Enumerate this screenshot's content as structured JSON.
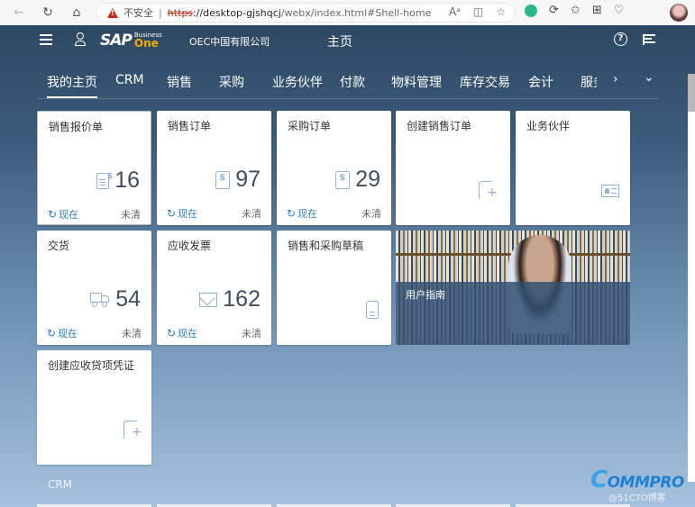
{
  "browser": {
    "insecure_label": "不安全",
    "url_scheme": "https",
    "url_host": "://desktop-gjshqcj",
    "url_path": "/webx/index.html#Shell-home",
    "icons": [
      "back-icon",
      "reload-icon",
      "home-icon",
      "read-aloud-icon",
      "split-screen-icon",
      "favorite-star-icon",
      "copilot-icon",
      "extensions-icon",
      "favorites-icon",
      "collections-icon",
      "browser-health-icon",
      "profile-avatar"
    ]
  },
  "shell": {
    "brand_primary": "SAP",
    "brand_business": "Business",
    "brand_one": "One",
    "company": "OEC中国有限公司",
    "title": "主页",
    "help_icon_label": "?",
    "accent_color": "#2d80c7",
    "brand_yellow": "#f0ab00"
  },
  "tabs": [
    {
      "label": "我的主页",
      "active": true
    },
    {
      "label": "CRM",
      "active": false
    },
    {
      "label": "销售",
      "active": false
    },
    {
      "label": "采购",
      "active": false
    },
    {
      "label": "业务伙伴",
      "active": false
    },
    {
      "label": "付款",
      "active": false
    },
    {
      "label": "物料管理",
      "active": false
    },
    {
      "label": "库存交易",
      "active": false
    },
    {
      "label": "会计",
      "active": false
    },
    {
      "label": "服务",
      "active": false
    }
  ],
  "tab_more_icon": "›",
  "tab_overflow_icon": "⌄",
  "tiles": [
    {
      "title": "销售报价单",
      "icon": "document-dollar-icon",
      "count": "16",
      "refresh": "现在",
      "status": "未清"
    },
    {
      "title": "销售订单",
      "icon": "document-dollar-icon",
      "count": "97",
      "refresh": "现在",
      "status": "未清"
    },
    {
      "title": "采购订单",
      "icon": "document-dollar-icon",
      "count": "29",
      "refresh": "现在",
      "status": "未清"
    },
    {
      "title": "创建销售订单",
      "icon": "new-document-icon"
    },
    {
      "title": "业务伙伴",
      "icon": "contact-card-icon"
    },
    {
      "title": "交货",
      "icon": "truck-icon",
      "count": "54",
      "refresh": "现在",
      "status": "未清"
    },
    {
      "title": "应收发票",
      "icon": "envelope-money-icon",
      "count": "162",
      "refresh": "现在",
      "status": "未清"
    },
    {
      "title": "销售和采购草稿",
      "icon": "document-icon"
    },
    {
      "title": "用户指南",
      "icon": "user-guide-image"
    },
    {
      "title": "创建应收贷项凭证",
      "icon": "new-document-icon"
    }
  ],
  "section_title": "CRM",
  "watermark": {
    "logo": "OMMPRO",
    "sub": "@51CTO博客"
  }
}
